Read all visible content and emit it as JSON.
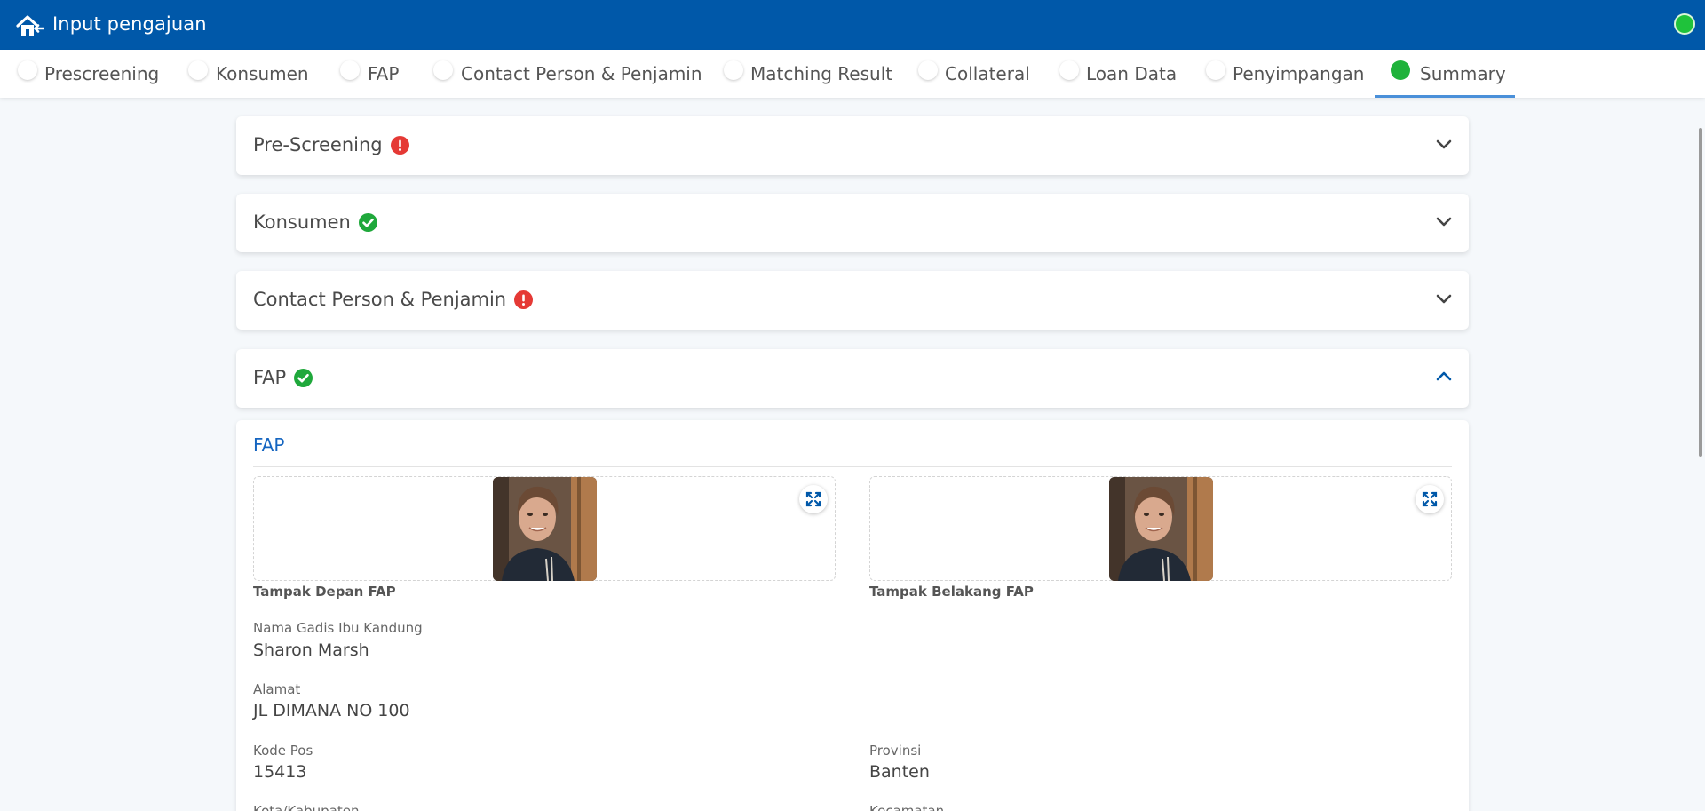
{
  "app": {
    "title": "Input pengajuan"
  },
  "steps": [
    {
      "label": "Prescreening",
      "active": false
    },
    {
      "label": "Konsumen",
      "active": false
    },
    {
      "label": "FAP",
      "active": false
    },
    {
      "label": "Contact Person & Penjamin",
      "active": false
    },
    {
      "label": "Matching Result",
      "active": false
    },
    {
      "label": "Collateral",
      "active": false
    },
    {
      "label": "Loan Data",
      "active": false
    },
    {
      "label": "Penyimpangan",
      "active": false
    },
    {
      "label": "Summary",
      "active": true
    }
  ],
  "sections": [
    {
      "title": "Pre-Screening",
      "status": "error",
      "expanded": false
    },
    {
      "title": "Konsumen",
      "status": "ok",
      "expanded": false
    },
    {
      "title": "Contact Person & Penjamin",
      "status": "error",
      "expanded": false
    },
    {
      "title": "FAP",
      "status": "ok",
      "expanded": true
    }
  ],
  "fap_panel": {
    "title": "FAP",
    "photos": [
      {
        "caption": "Tampak Depan FAP"
      },
      {
        "caption": "Tampak Belakang FAP"
      }
    ],
    "fields": {
      "nama_gadis_ibu_kandung": {
        "label": "Nama Gadis Ibu Kandung",
        "value": "Sharon Marsh"
      },
      "alamat": {
        "label": "Alamat",
        "value": "JL DIMANA NO 100"
      },
      "kode_pos": {
        "label": "Kode Pos",
        "value": "15413"
      },
      "provinsi": {
        "label": "Provinsi",
        "value": "Banten"
      },
      "kota_kabupaten": {
        "label": "Kota/Kabupaten"
      },
      "kecamatan": {
        "label": "Kecamatan"
      }
    }
  },
  "colors": {
    "header": "#0058a9",
    "active_step": "#1fb23b",
    "status_online": "#1fc23b",
    "error": "#e53935",
    "ok": "#1fa83b",
    "panel_title": "#1565c0"
  },
  "icons": {
    "home": "home-back-icon",
    "error": "exclamation-circle-icon",
    "ok": "check-circle-icon",
    "collapsed": "chevron-down-icon",
    "expanded": "chevron-up-icon",
    "expand": "expand-icon"
  }
}
